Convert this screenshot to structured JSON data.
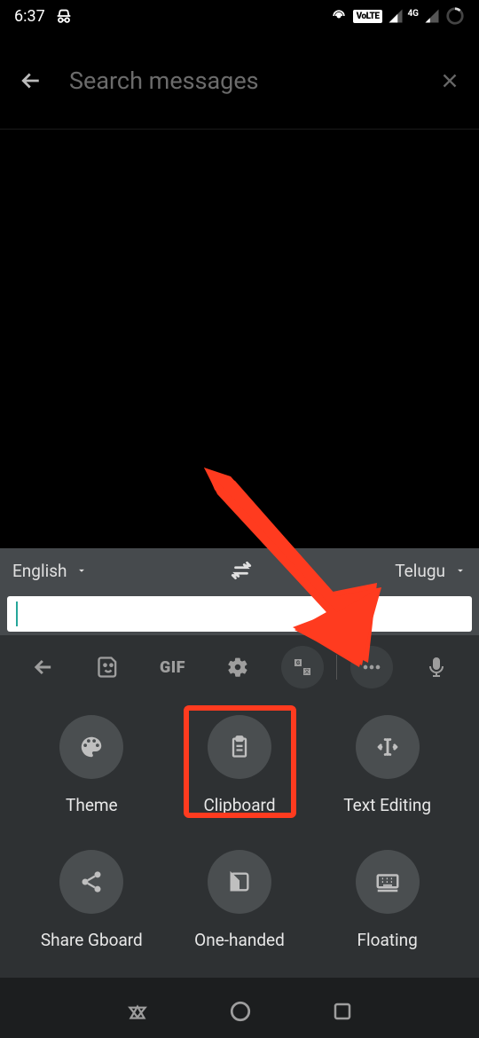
{
  "status": {
    "time": "6:37",
    "volte": "VoLTE",
    "network_gen": "4G"
  },
  "search": {
    "placeholder": "Search messages"
  },
  "translate": {
    "source_lang": "English",
    "target_lang": "Telugu"
  },
  "toolbar": {
    "gif_label": "GIF"
  },
  "grid": {
    "theme": "Theme",
    "clipboard": "Clipboard",
    "text_editing": "Text Editing",
    "share": "Share Gboard",
    "one_handed": "One-handed",
    "floating": "Floating"
  },
  "annotation": {
    "highlighted_item": "Clipboard",
    "arrow_target": "more-button"
  }
}
